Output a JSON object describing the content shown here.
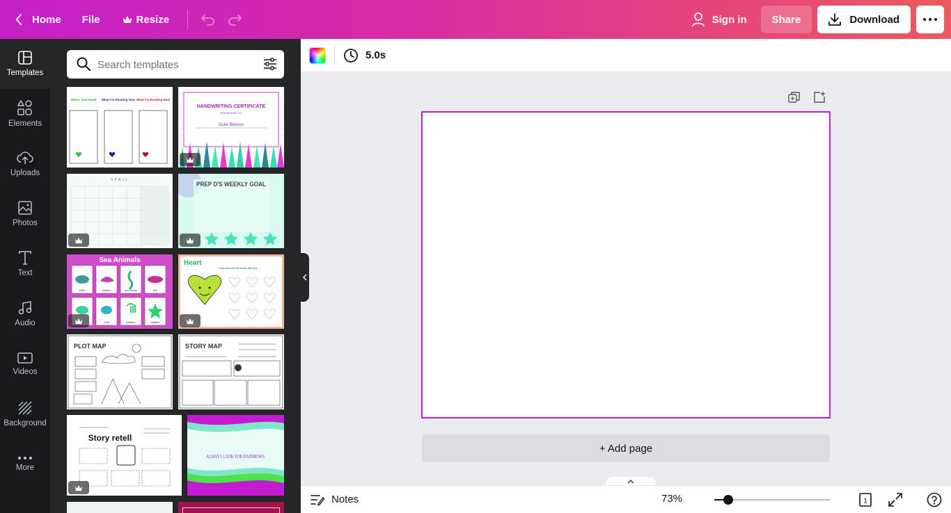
{
  "topbar": {
    "home_label": "Home",
    "file_label": "File",
    "resize_label": "Resize",
    "signin_label": "Sign in",
    "share_label": "Share",
    "download_label": "Download"
  },
  "rail": {
    "items": [
      {
        "label": "Templates",
        "icon": "templates-icon"
      },
      {
        "label": "Elements",
        "icon": "elements-icon"
      },
      {
        "label": "Uploads",
        "icon": "uploads-icon"
      },
      {
        "label": "Photos",
        "icon": "photos-icon"
      },
      {
        "label": "Text",
        "icon": "text-icon"
      },
      {
        "label": "Audio",
        "icon": "audio-icon"
      },
      {
        "label": "Videos",
        "icon": "videos-icon"
      },
      {
        "label": "Background",
        "icon": "background-icon"
      },
      {
        "label": "More",
        "icon": "more-icon"
      }
    ]
  },
  "search": {
    "placeholder": "Search templates"
  },
  "templates": [
    {
      "title_parts": [
        "What I Just Read",
        "What I'm Reading Now",
        "What I'm Reading Next"
      ],
      "premium": false
    },
    {
      "title": "HANDWRITING CERTIFICATE",
      "subtitle": "PRESENTED TO",
      "name": "Duke Benson",
      "premium": true
    },
    {
      "title": "APRIL",
      "premium": true
    },
    {
      "title": "PREP D'S WEEKLY GOAL",
      "premium": true
    },
    {
      "title": "Sea Animals",
      "labels": [
        "turtle",
        "dolphin",
        "sea horse",
        "fish",
        "crab",
        "jellyfish",
        "starfish"
      ],
      "premium": true
    },
    {
      "title": "Heart",
      "instruction": "Trace and color the hearts with pins.",
      "premium": true
    },
    {
      "title": "PLOT MAP",
      "premium": false
    },
    {
      "title": "STORY MAP",
      "premium": false
    },
    {
      "title": "Story retell",
      "premium": true
    },
    {
      "title": "ALWAYS LOOK FOR RAINBOWS",
      "premium": false
    }
  ],
  "editor": {
    "timer": "5.0s",
    "add_page_label": "+ Add page"
  },
  "footer": {
    "notes_label": "Notes",
    "zoom_label": "73%",
    "zoom_fraction": 0.12,
    "page_count": "1"
  },
  "colors": {
    "accent": "#c01ec8",
    "rail_bg": "#18191b",
    "panel_bg": "#252627",
    "canvas_bg": "#ebecf0"
  }
}
